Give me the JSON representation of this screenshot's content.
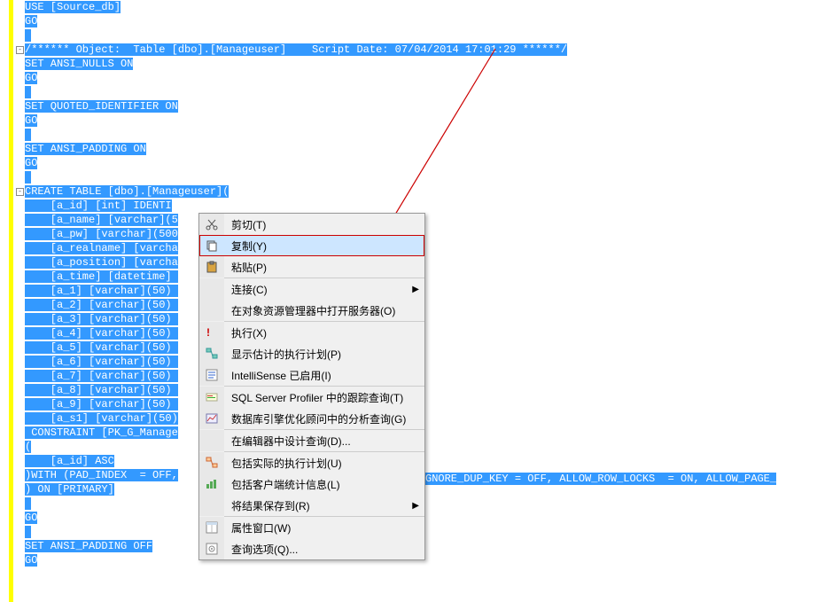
{
  "code_lines": [
    {
      "indent": 0,
      "text": "USE [Source_db]"
    },
    {
      "indent": 0,
      "text": "GO"
    },
    {
      "indent": 0,
      "text": ""
    },
    {
      "indent": 0,
      "text": "/****** Object:  Table [dbo].[Manageuser]    Script Date: 07/04/2014 17:01:29 ******/"
    },
    {
      "indent": 0,
      "text": "SET ANSI_NULLS ON"
    },
    {
      "indent": 0,
      "text": "GO"
    },
    {
      "indent": 0,
      "text": ""
    },
    {
      "indent": 0,
      "text": "SET QUOTED_IDENTIFIER ON"
    },
    {
      "indent": 0,
      "text": "GO"
    },
    {
      "indent": 0,
      "text": ""
    },
    {
      "indent": 0,
      "text": "SET ANSI_PADDING ON"
    },
    {
      "indent": 0,
      "text": "GO"
    },
    {
      "indent": 0,
      "text": ""
    },
    {
      "indent": 0,
      "text": "CREATE TABLE [dbo].[Manageuser]("
    },
    {
      "indent": 1,
      "text": "[a_id] [int] IDENTI"
    },
    {
      "indent": 1,
      "text": "[a_name] [varchar](5"
    },
    {
      "indent": 1,
      "text": "[a_pw] [varchar](500"
    },
    {
      "indent": 1,
      "text": "[a_realname] [varcha"
    },
    {
      "indent": 1,
      "text": "[a_position] [varcha"
    },
    {
      "indent": 1,
      "text": "[a_time] [datetime] "
    },
    {
      "indent": 1,
      "text": "[a_1] [varchar](50) "
    },
    {
      "indent": 1,
      "text": "[a_2] [varchar](50) "
    },
    {
      "indent": 1,
      "text": "[a_3] [varchar](50) "
    },
    {
      "indent": 1,
      "text": "[a_4] [varchar](50) "
    },
    {
      "indent": 1,
      "text": "[a_5] [varchar](50) "
    },
    {
      "indent": 1,
      "text": "[a_6] [varchar](50) "
    },
    {
      "indent": 1,
      "text": "[a_7] [varchar](50) "
    },
    {
      "indent": 1,
      "text": "[a_8] [varchar](50) "
    },
    {
      "indent": 1,
      "text": "[a_9] [varchar](50) "
    },
    {
      "indent": 1,
      "text": "[a_s1] [varchar](50)"
    },
    {
      "indent": 0,
      "text": " CONSTRAINT [PK_G_Manage"
    },
    {
      "indent": 0,
      "text": "("
    },
    {
      "indent": 1,
      "text": "[a_id] ASC"
    },
    {
      "indent": 0,
      "text": ")WITH (PAD_INDEX  = OFF,"
    },
    {
      "indent": 0,
      "text": ") ON [PRIMARY]"
    },
    {
      "indent": 0,
      "text": ""
    },
    {
      "indent": 0,
      "text": "GO"
    },
    {
      "indent": 0,
      "text": ""
    },
    {
      "indent": 0,
      "text": "SET ANSI_PADDING OFF"
    },
    {
      "indent": 0,
      "text": "GO"
    }
  ],
  "overflow_line34": "GNORE_DUP_KEY = OFF, ALLOW_ROW_LOCKS  = ON, ALLOW_PAGE_",
  "menu": {
    "items": [
      {
        "label": "剪切(T)",
        "icon": "cut",
        "sep_after": false
      },
      {
        "label": "复制(Y)",
        "icon": "copy",
        "highlighted": true,
        "boxed": true
      },
      {
        "label": "粘贴(P)",
        "icon": "paste",
        "sep_after": true
      },
      {
        "label": "连接(C)",
        "submenu": true
      },
      {
        "label": "在对象资源管理器中打开服务器(O)",
        "sep_after": true
      },
      {
        "label": "执行(X)",
        "icon": "execute"
      },
      {
        "label": "显示估计的执行计划(P)",
        "icon": "plan"
      },
      {
        "label": "IntelliSense 已启用(I)",
        "icon": "intellisense",
        "sep_after": true
      },
      {
        "label": "SQL Server Profiler 中的跟踪查询(T)",
        "icon": "profiler"
      },
      {
        "label": "数据库引擎优化顾问中的分析查询(G)",
        "icon": "tuning",
        "sep_after": true
      },
      {
        "label": "在编辑器中设计查询(D)...",
        "sep_after": true
      },
      {
        "label": "包括实际的执行计划(U)",
        "icon": "plan2"
      },
      {
        "label": "包括客户端统计信息(L)",
        "icon": "stats"
      },
      {
        "label": "将结果保存到(R)",
        "submenu": true,
        "sep_after": true
      },
      {
        "label": "属性窗口(W)",
        "icon": "props"
      },
      {
        "label": "查询选项(Q)...",
        "icon": "options"
      }
    ]
  }
}
